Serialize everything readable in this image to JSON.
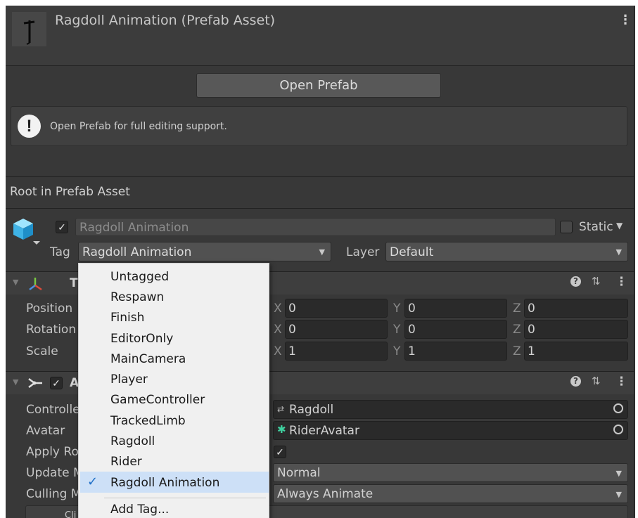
{
  "header": {
    "title": "Ragdoll Animation (Prefab Asset)",
    "kebab": "⋮"
  },
  "open_prefab": {
    "label": "Open Prefab"
  },
  "info": {
    "message": "Open Prefab for full editing support."
  },
  "section": {
    "title": "Root in Prefab Asset"
  },
  "gameobject": {
    "name": "Ragdoll Animation",
    "static_label": "Static",
    "tag_label": "Tag",
    "tag_value": "Ragdoll Animation",
    "layer_label": "Layer",
    "layer_value": "Default"
  },
  "transform": {
    "title": "T",
    "rows": [
      {
        "label": "Position",
        "x": "0",
        "y": "0",
        "z": "0"
      },
      {
        "label": "Rotation",
        "x": "0",
        "y": "0",
        "z": "0"
      },
      {
        "label": "Scale",
        "x": "1",
        "y": "1",
        "z": "1"
      }
    ]
  },
  "animator": {
    "title": "A",
    "rows": [
      {
        "label": "Controlle",
        "value": "Ragdoll"
      },
      {
        "label": "Avatar",
        "value": "RiderAvatar"
      },
      {
        "label": "Apply Ro",
        "value": "✓"
      },
      {
        "label": "Update M",
        "value": "Normal"
      },
      {
        "label": "Culling M",
        "value": "Always Animate"
      }
    ],
    "partial_row": "Cli"
  },
  "axes": {
    "x": "X",
    "y": "Y",
    "z": "Z"
  },
  "tag_menu": {
    "items": [
      "Untagged",
      "Respawn",
      "Finish",
      "EditorOnly",
      "MainCamera",
      "Player",
      "GameController",
      "TrackedLimb",
      "Ragdoll",
      "Rider",
      "Ragdoll Animation"
    ],
    "selected": "Ragdoll Animation",
    "add_tag": "Add Tag..."
  },
  "colors": {
    "panel": "#383838",
    "menu_bg": "#f0f0f0",
    "selected_bg": "#cde0f7",
    "check": "#1f6fc7"
  }
}
